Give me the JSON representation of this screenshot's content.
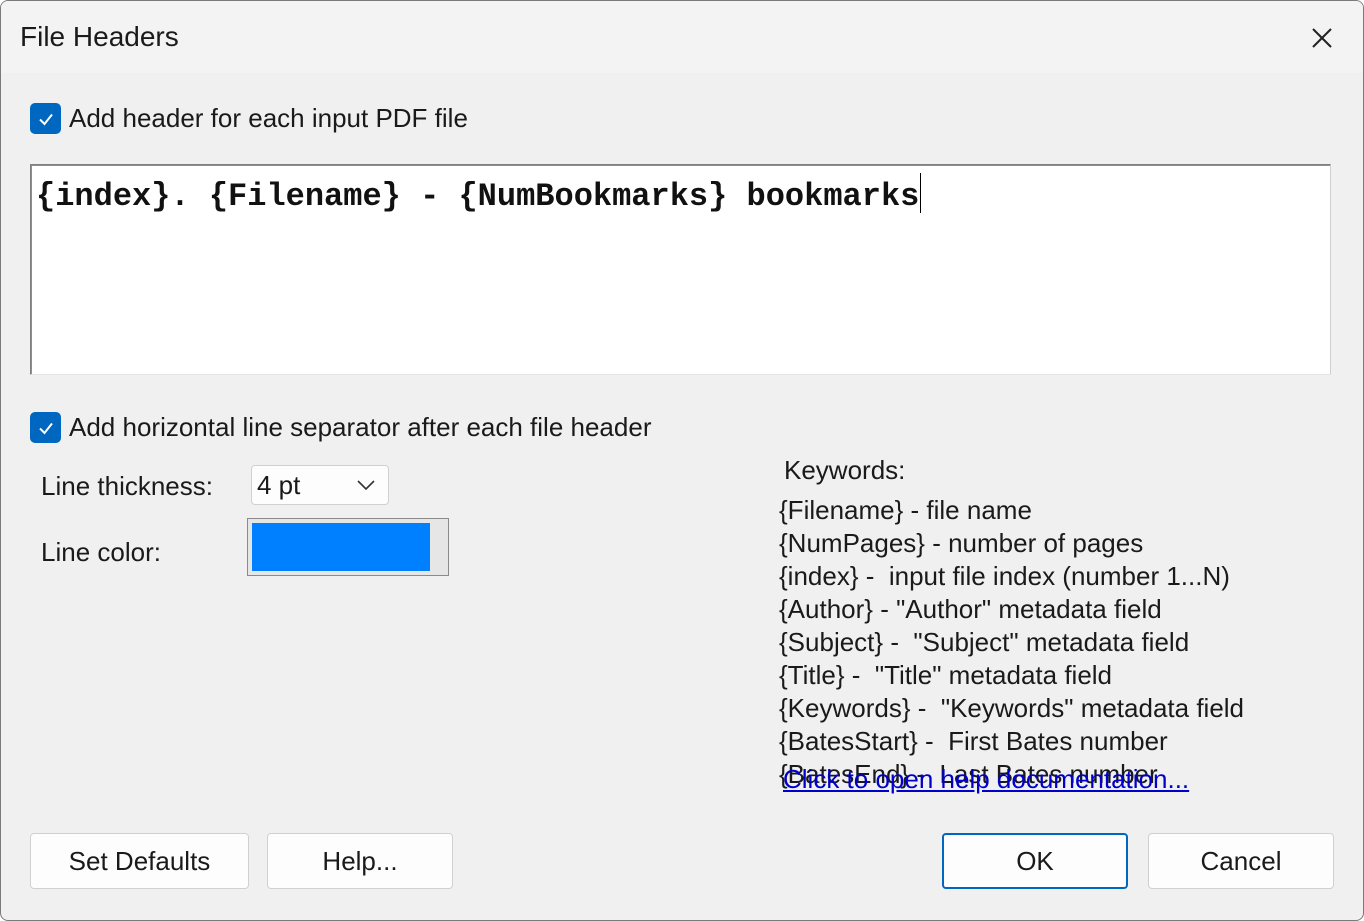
{
  "window": {
    "title": "File Headers"
  },
  "header_checkbox": {
    "label": "Add header for each input PDF file",
    "checked": true
  },
  "header_template": {
    "value": "{index}. {Filename} - {NumBookmarks} bookmarks"
  },
  "separator_checkbox": {
    "label": "Add horizontal line separator after each file header",
    "checked": true
  },
  "line_thickness": {
    "label": "Line thickness:",
    "value": "4 pt"
  },
  "line_color": {
    "label": "Line color:",
    "color": "#0080ff"
  },
  "keywords": {
    "heading": "Keywords:",
    "items": [
      "{Filename} - file name",
      "{NumPages} - number of pages",
      "{index} -  input file index (number 1...N)",
      "{Author} - \"Author\" metadata field",
      "{Subject} -  \"Subject\" metadata field",
      "{Title} -  \"Title\" metadata field",
      "{Keywords} -  \"Keywords\" metadata field",
      "{BatesStart} -  First Bates number",
      "{BatesEnd} -  Last Bates number"
    ]
  },
  "help_link": "Click to open help documentation...",
  "buttons": {
    "set_defaults": "Set Defaults",
    "help": "Help...",
    "ok": "OK",
    "cancel": "Cancel"
  },
  "colors": {
    "accent": "#0067c0",
    "link": "#0000cc"
  }
}
